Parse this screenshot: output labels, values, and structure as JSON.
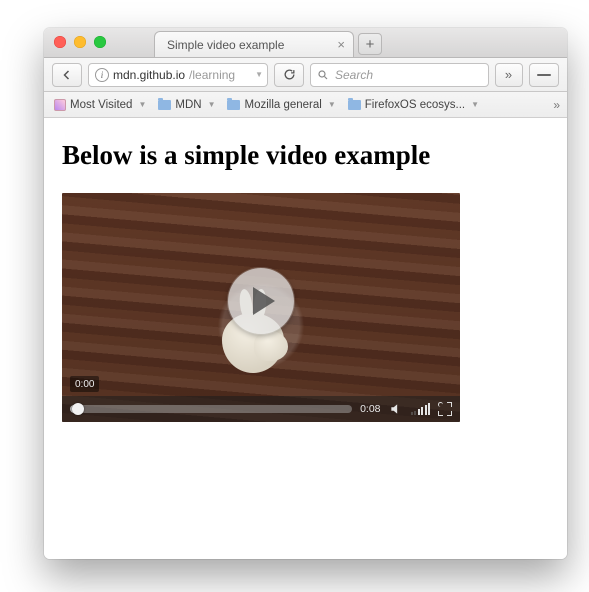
{
  "window": {
    "tab_title": "Simple video example"
  },
  "toolbar": {
    "url_host": "mdn.github.io",
    "url_path": "/learning",
    "search_placeholder": "Search"
  },
  "bookmarks": {
    "items": [
      {
        "label": "Most Visited"
      },
      {
        "label": "MDN"
      },
      {
        "label": "Mozilla general"
      },
      {
        "label": "FirefoxOS ecosys..."
      }
    ]
  },
  "page": {
    "heading": "Below is a simple video example"
  },
  "video": {
    "current_time": "0:00",
    "duration": "0:08"
  }
}
